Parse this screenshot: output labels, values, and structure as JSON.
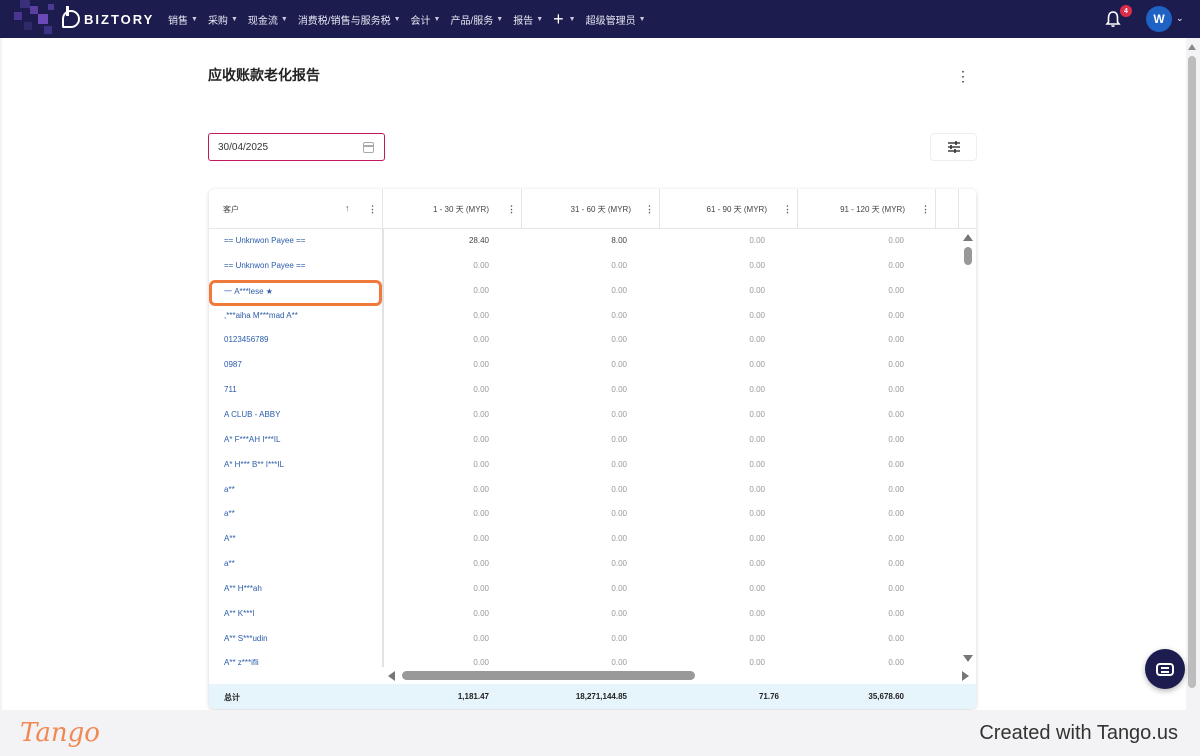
{
  "app": {
    "brand": "BIZTORY",
    "nav": [
      {
        "label": "销售"
      },
      {
        "label": "采购"
      },
      {
        "label": "现金流"
      },
      {
        "label": "消费税/销售与服务税"
      },
      {
        "label": "会计"
      },
      {
        "label": "产品/服务"
      },
      {
        "label": "报告"
      }
    ],
    "plus_label": "+",
    "admin_label": "超级管理员",
    "notifications_count": "4",
    "avatar_initial": "W"
  },
  "report": {
    "title": "应收账款老化报告",
    "date_value": "30/04/2025"
  },
  "table": {
    "headers": {
      "customer": "客户",
      "col1": "1 - 30 天 (MYR)",
      "col2": "31 - 60 天 (MYR)",
      "col3": "61 - 90 天 (MYR)",
      "col4": "91 - 120 天 (MYR)"
    },
    "rows": [
      {
        "customer": "== Unknwon Payee ==",
        "c1": "28.40",
        "c2": "8.00",
        "c3": "0.00",
        "c4": "0.00"
      },
      {
        "customer": "== Unknwon Payee ==",
        "c1": "0.00",
        "c2": "0.00",
        "c3": "0.00",
        "c4": "0.00"
      },
      {
        "customer": "一 A***lese ★",
        "c1": "0.00",
        "c2": "0.00",
        "c3": "0.00",
        "c4": "0.00"
      },
      {
        "customer": ",***aiha M***mad A**",
        "c1": "0.00",
        "c2": "0.00",
        "c3": "0.00",
        "c4": "0.00"
      },
      {
        "customer": "0123456789",
        "c1": "0.00",
        "c2": "0.00",
        "c3": "0.00",
        "c4": "0.00"
      },
      {
        "customer": "0987",
        "c1": "0.00",
        "c2": "0.00",
        "c3": "0.00",
        "c4": "0.00"
      },
      {
        "customer": "711",
        "c1": "0.00",
        "c2": "0.00",
        "c3": "0.00",
        "c4": "0.00"
      },
      {
        "customer": "A CLUB - ABBY",
        "c1": "0.00",
        "c2": "0.00",
        "c3": "0.00",
        "c4": "0.00"
      },
      {
        "customer": "A* F***AH I***IL",
        "c1": "0.00",
        "c2": "0.00",
        "c3": "0.00",
        "c4": "0.00"
      },
      {
        "customer": "A* H*** B** I***IL",
        "c1": "0.00",
        "c2": "0.00",
        "c3": "0.00",
        "c4": "0.00"
      },
      {
        "customer": "a**",
        "c1": "0.00",
        "c2": "0.00",
        "c3": "0.00",
        "c4": "0.00"
      },
      {
        "customer": "a**",
        "c1": "0.00",
        "c2": "0.00",
        "c3": "0.00",
        "c4": "0.00"
      },
      {
        "customer": "A**",
        "c1": "0.00",
        "c2": "0.00",
        "c3": "0.00",
        "c4": "0.00"
      },
      {
        "customer": "a**",
        "c1": "0.00",
        "c2": "0.00",
        "c3": "0.00",
        "c4": "0.00"
      },
      {
        "customer": "A** H***ah",
        "c1": "0.00",
        "c2": "0.00",
        "c3": "0.00",
        "c4": "0.00"
      },
      {
        "customer": "A** K***l",
        "c1": "0.00",
        "c2": "0.00",
        "c3": "0.00",
        "c4": "0.00"
      },
      {
        "customer": "A** S***udin",
        "c1": "0.00",
        "c2": "0.00",
        "c3": "0.00",
        "c4": "0.00"
      },
      {
        "customer": "A** z***ifli",
        "c1": "0.00",
        "c2": "0.00",
        "c3": "0.00",
        "c4": "0.00"
      }
    ],
    "totals": {
      "label": "总计",
      "c1": "1,181.47",
      "c2": "18,271,144.85",
      "c3": "71.76",
      "c4": "35,678.60"
    }
  },
  "footer": {
    "logo": "Tango",
    "credit": "Created with Tango.us"
  },
  "colors": {
    "topbar": "#1c1c4e",
    "accent_input": "#c2185b",
    "highlight": "#f07a3c",
    "link": "#2a5ca8",
    "totals_bg": "#e6f4fb"
  }
}
